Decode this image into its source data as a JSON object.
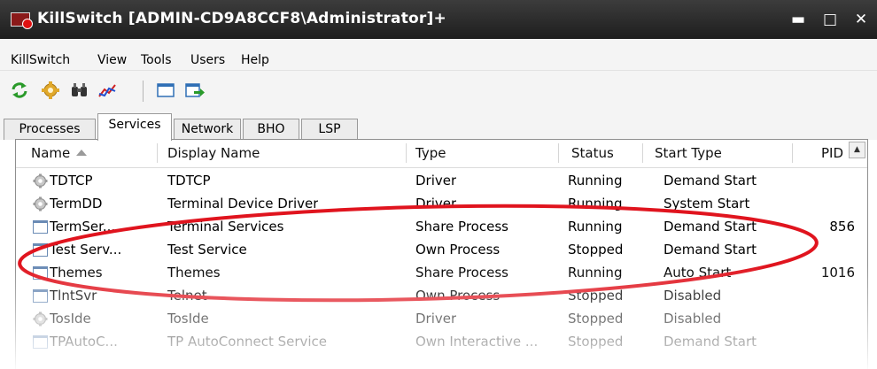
{
  "window": {
    "title": "KillSwitch [ADMIN-CD9A8CCF8\\Administrator]+",
    "minimize_glyph": "▬",
    "maximize_glyph": "□",
    "close_glyph": "✕"
  },
  "menu": [
    {
      "label": "KillSwitch"
    },
    {
      "label": "View"
    },
    {
      "label": "Tools"
    },
    {
      "label": "Users"
    },
    {
      "label": "Help"
    }
  ],
  "toolbar": [
    "refresh-icon",
    "settings-icon",
    "find-icon",
    "graph-icon",
    "window-icon",
    "export-icon"
  ],
  "tabs": [
    {
      "label": "Processes",
      "active": false
    },
    {
      "label": "Services",
      "active": true
    },
    {
      "label": "Network",
      "active": false
    },
    {
      "label": "BHO",
      "active": false
    },
    {
      "label": "LSP",
      "active": false
    }
  ],
  "columns": {
    "name": "Name",
    "display_name": "Display Name",
    "type": "Type",
    "status": "Status",
    "start_type": "Start Type",
    "pid": "PID"
  },
  "rows": [
    {
      "name": "TDTCP",
      "display_name": "TDTCP",
      "type": "Driver",
      "status": "Running",
      "start_type": "Demand Start",
      "pid": "",
      "icon": "gear-icon"
    },
    {
      "name": "TermDD",
      "display_name": "Terminal Device Driver",
      "type": "Driver",
      "status": "Running",
      "start_type": "System Start",
      "pid": "",
      "icon": "gear-icon"
    },
    {
      "name": "TermSer...",
      "display_name": "Terminal Services",
      "type": "Share Process",
      "status": "Running",
      "start_type": "Demand Start",
      "pid": "856",
      "icon": "window-icon"
    },
    {
      "name": "Test Serv...",
      "display_name": "Test Service",
      "type": "Own Process",
      "status": "Stopped",
      "start_type": "Demand Start",
      "pid": "",
      "icon": "window-icon"
    },
    {
      "name": "Themes",
      "display_name": "Themes",
      "type": "Share Process",
      "status": "Running",
      "start_type": "Auto Start",
      "pid": "1016",
      "icon": "window-icon"
    },
    {
      "name": "TlntSvr",
      "display_name": "Telnet",
      "type": "Own Process",
      "status": "Stopped",
      "start_type": "Disabled",
      "pid": "",
      "icon": "window-icon"
    },
    {
      "name": "TosIde",
      "display_name": "TosIde",
      "type": "Driver",
      "status": "Stopped",
      "start_type": "Disabled",
      "pid": "",
      "icon": "gear-icon"
    },
    {
      "name": "TPAutoC...",
      "display_name": "TP AutoConnect Service",
      "type": "Own Interactive ...",
      "status": "Stopped",
      "start_type": "Demand Start",
      "pid": "",
      "icon": "window-icon"
    }
  ],
  "colors": {
    "title_bar": "#2b2b2b",
    "annotation": "#e0141e",
    "window_icon": "#6a8bb5"
  }
}
